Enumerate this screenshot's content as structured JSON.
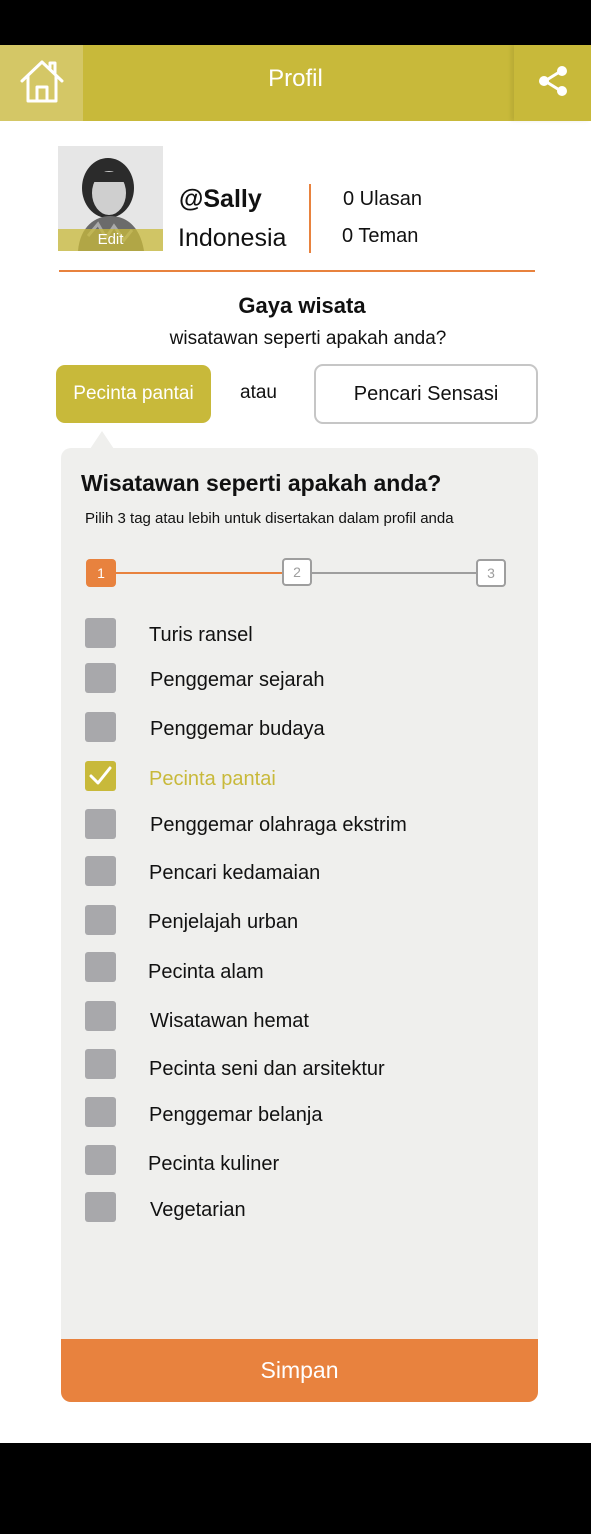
{
  "header": {
    "title": "Profil",
    "home_icon": "home-icon",
    "share_icon": "share-icon",
    "color": "#c8b93a"
  },
  "profile": {
    "avatar_edit_label": "Edit",
    "username": "@Sally",
    "country": "Indonesia",
    "reviews": "0 Ulasan",
    "friends": "0 Teman"
  },
  "travel_style": {
    "title": "Gaya wisata",
    "subtitle": "wisatawan seperti apakah anda?",
    "option_left": "Pecinta pantai",
    "separator": "atau",
    "option_right": "Pencari Sensasi"
  },
  "panel": {
    "title": "Wisatawan seperti apakah anda?",
    "subtitle": "Pilih 3 tag atau lebih untuk disertakan dalam profil anda",
    "steps": [
      "1",
      "2",
      "3"
    ],
    "active_step": "1",
    "options": [
      {
        "label": "Turis ransel",
        "checked": false
      },
      {
        "label": "Penggemar sejarah",
        "checked": false
      },
      {
        "label": "Penggemar budaya",
        "checked": false
      },
      {
        "label": "Pecinta pantai",
        "checked": true
      },
      {
        "label": "Penggemar olahraga ekstrim",
        "checked": false
      },
      {
        "label": "Pencari kedamaian",
        "checked": false
      },
      {
        "label": "Penjelajah urban",
        "checked": false
      },
      {
        "label": "Pecinta alam",
        "checked": false
      },
      {
        "label": "Wisatawan hemat",
        "checked": false
      },
      {
        "label": "Pecinta seni dan arsitektur",
        "checked": false
      },
      {
        "label": "Penggemar belanja",
        "checked": false
      },
      {
        "label": "Pecinta kuliner",
        "checked": false
      },
      {
        "label": "Vegetarian",
        "checked": false
      }
    ],
    "save_label": "Simpan"
  },
  "colors": {
    "accent": "#c8b93a",
    "orange": "#e8823e",
    "panel_bg": "#efefed",
    "checkbox_off": "#a8a8ab"
  }
}
